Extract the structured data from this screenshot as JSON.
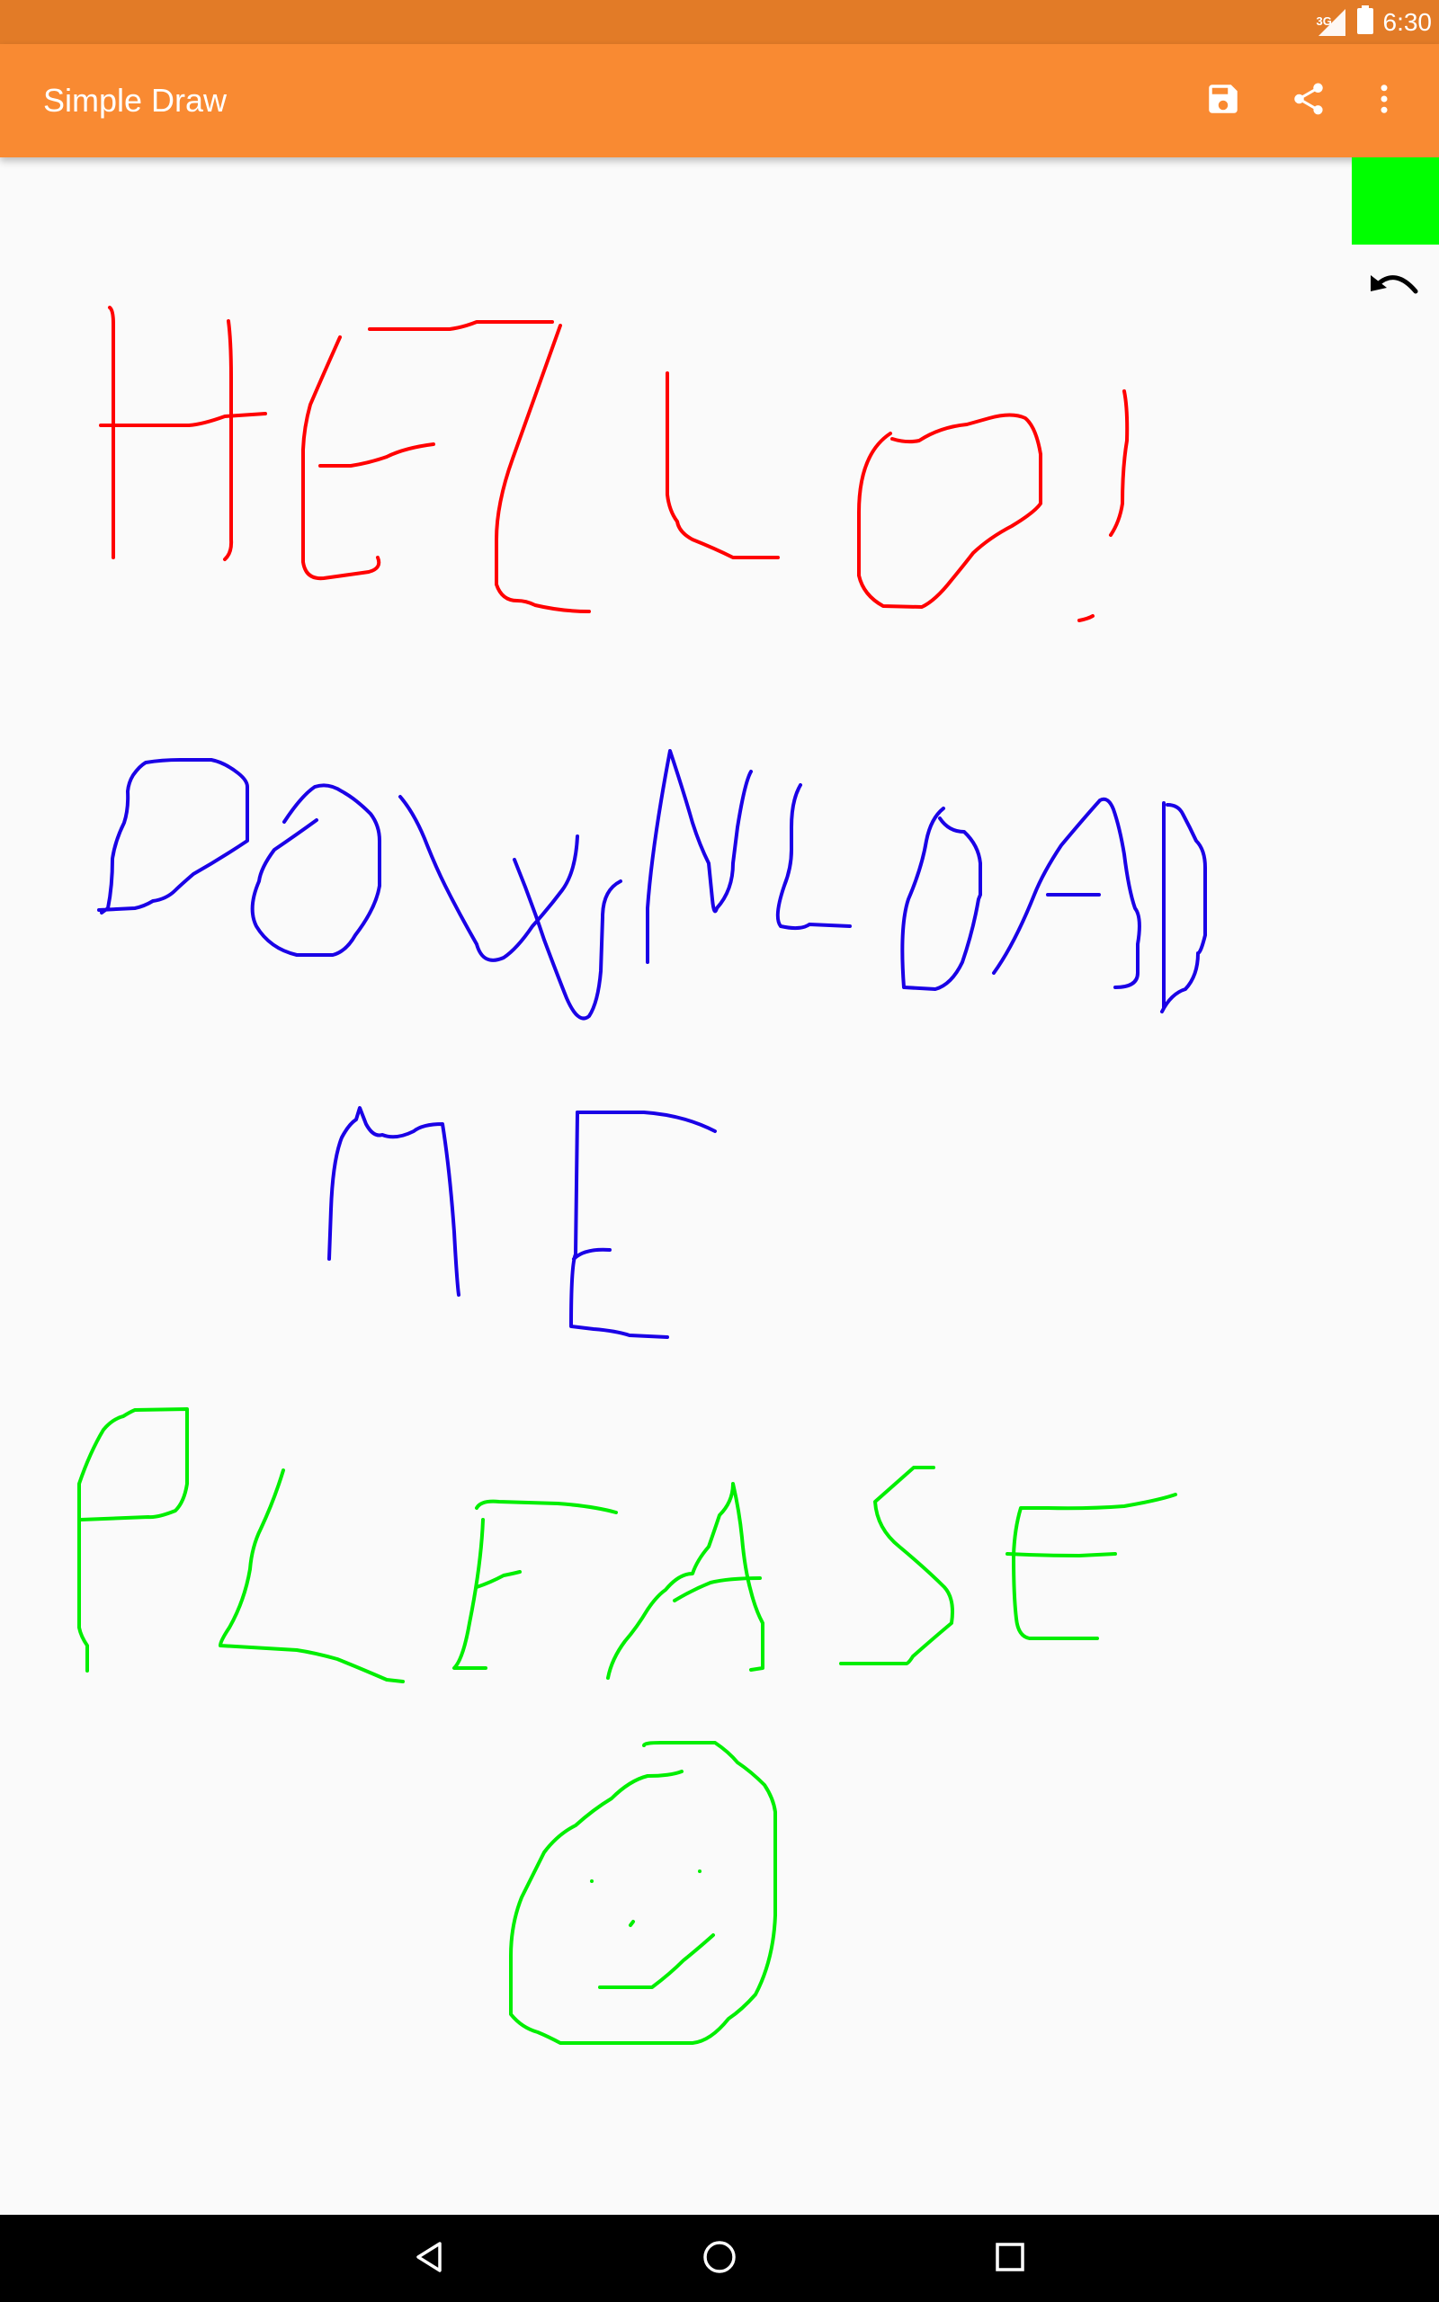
{
  "status_bar": {
    "time": "6:30",
    "network": "3G"
  },
  "app_bar": {
    "title": "Simple Draw",
    "actions": [
      {
        "name": "save-icon",
        "label": "Save"
      },
      {
        "name": "share-icon",
        "label": "Share"
      },
      {
        "name": "more-vert-icon",
        "label": "More options"
      }
    ]
  },
  "canvas": {
    "current_color": "#00ff00",
    "undo_icon": "undo-icon",
    "strokes": [
      {
        "color": "#ff0000",
        "description": "HELLO!"
      },
      {
        "color": "#0000ee",
        "description": "DOWNLOAD"
      },
      {
        "color": "#0000ee",
        "description": "ME"
      },
      {
        "color": "#00ee00",
        "description": "PLEASE"
      },
      {
        "color": "#00ee00",
        "description": "smiley face"
      }
    ]
  },
  "nav_bar": {
    "buttons": [
      "back-icon",
      "home-icon",
      "recents-icon"
    ]
  }
}
